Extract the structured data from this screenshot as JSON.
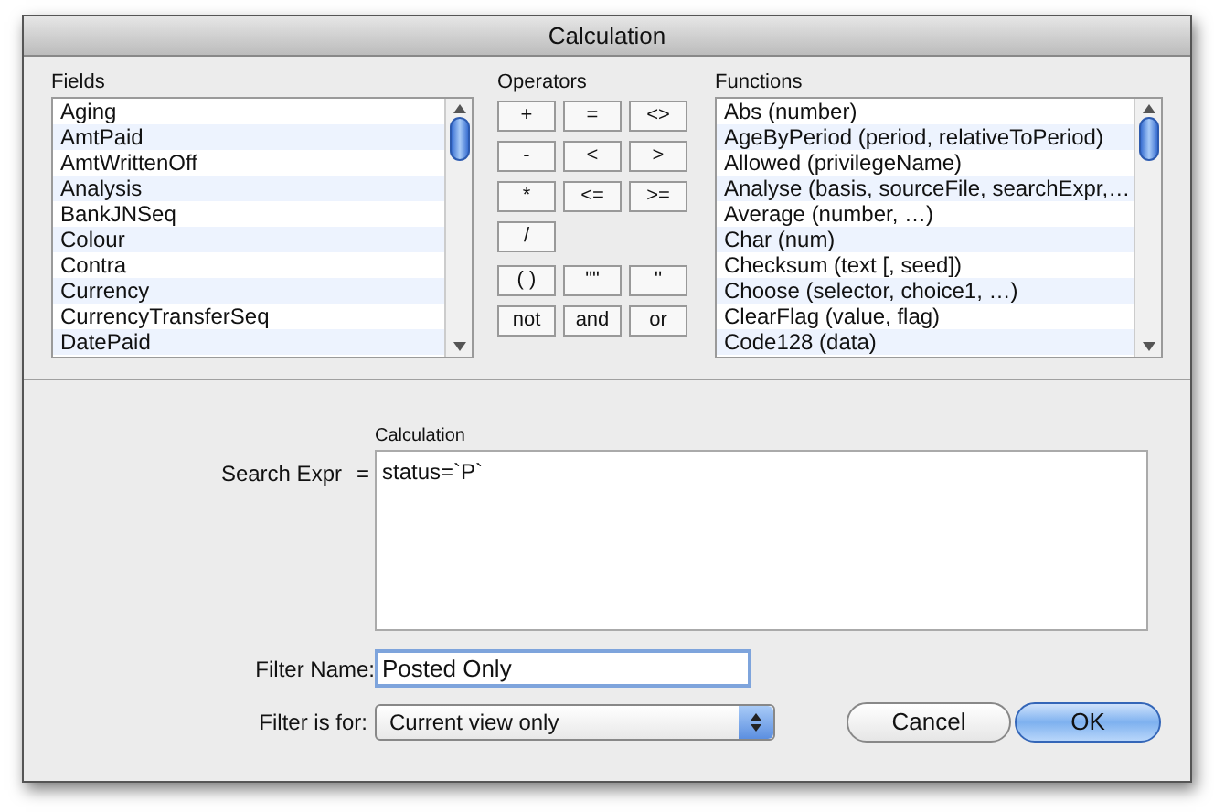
{
  "window": {
    "title": "Calculation"
  },
  "fields": {
    "label": "Fields",
    "items": [
      "Aging",
      "AmtPaid",
      "AmtWrittenOff",
      "Analysis",
      "BankJNSeq",
      "Colour",
      "Contra",
      "Currency",
      "CurrencyTransferSeq",
      "DatePaid"
    ]
  },
  "operators": {
    "label": "Operators",
    "groups": [
      [
        [
          "+",
          "=",
          "<>"
        ],
        [
          "-",
          "<",
          ">"
        ],
        [
          "*",
          "<=",
          ">="
        ],
        [
          "/"
        ]
      ],
      [
        [
          "( )",
          "\"\"",
          "''"
        ],
        [
          "not",
          "and",
          "or"
        ]
      ]
    ]
  },
  "functions": {
    "label": "Functions",
    "items": [
      "Abs (number)",
      "AgeByPeriod (period, relativeToPeriod)",
      "Allowed (privilegeName)",
      "Analyse (basis, sourceFile, searchExpr,…",
      "Average (number, …)",
      "Char (num)",
      "Checksum (text [, seed])",
      "Choose (selector, choice1, …)",
      "ClearFlag (value, flag)",
      "Code128 (data)"
    ]
  },
  "expression": {
    "caption": "Calculation",
    "label": "Search Expr",
    "operator": "=",
    "value": "status=`P`"
  },
  "filter_name": {
    "label": "Filter Name:",
    "value": "Posted Only"
  },
  "filter_for": {
    "label": "Filter is for:",
    "value": "Current view only"
  },
  "buttons": [
    {
      "label": "Cancel",
      "default": false
    },
    {
      "label": "OK",
      "default": true
    }
  ]
}
